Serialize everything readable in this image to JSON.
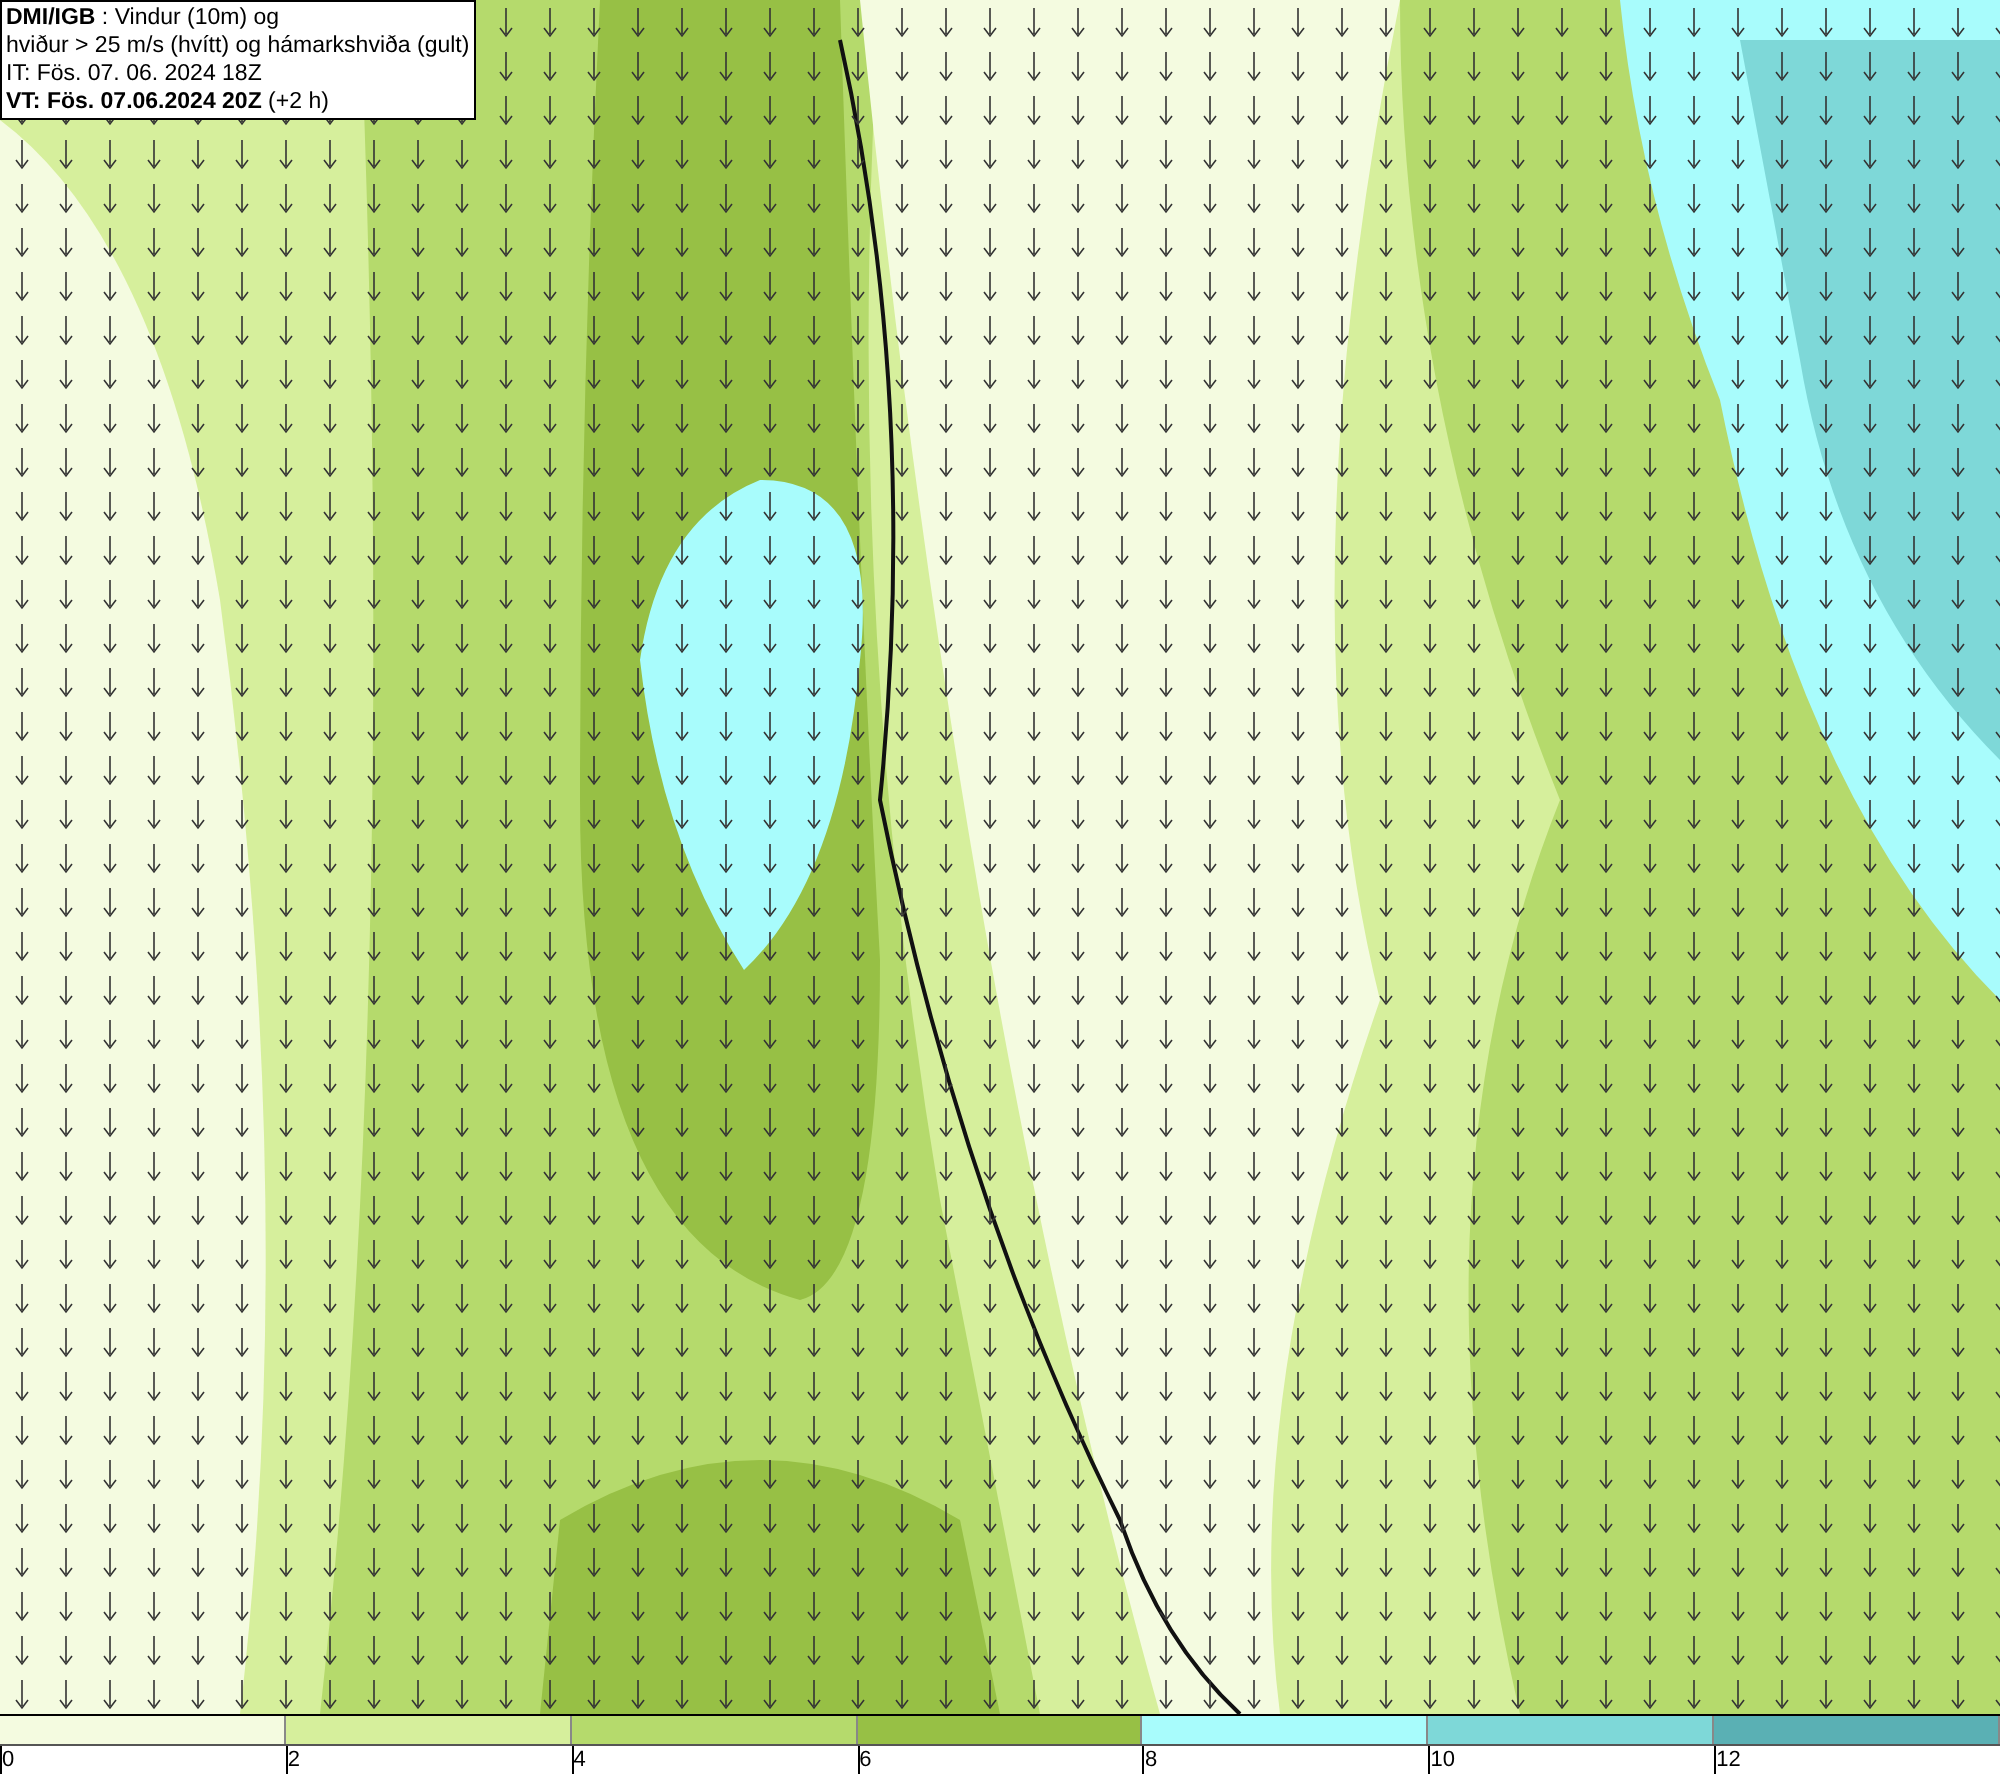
{
  "info_box": {
    "lines": [
      "**DMI/IGB** : Vindur (10m) og",
      "hviður > 25 m/s (hvítt) og hámarkshviða (gult)",
      "IT: Fös. 07. 06. 2024 18Z",
      "**VT: Fös. 07.06.2024 20Z** (+2 h)"
    ]
  },
  "legend": [
    {
      "label": "0",
      "color": "#f4fbe0"
    },
    {
      "label": "2",
      "color": "#d6ef9c"
    },
    {
      "label": "4",
      "color": "#b5da6c"
    },
    {
      "label": "6",
      "color": "#97c045"
    },
    {
      "label": "8",
      "color": "#a8fcfc"
    },
    {
      "label": "10",
      "color": "#7ed8d8"
    },
    {
      "label": "12",
      "color": "#5ab0b4"
    }
  ]
}
